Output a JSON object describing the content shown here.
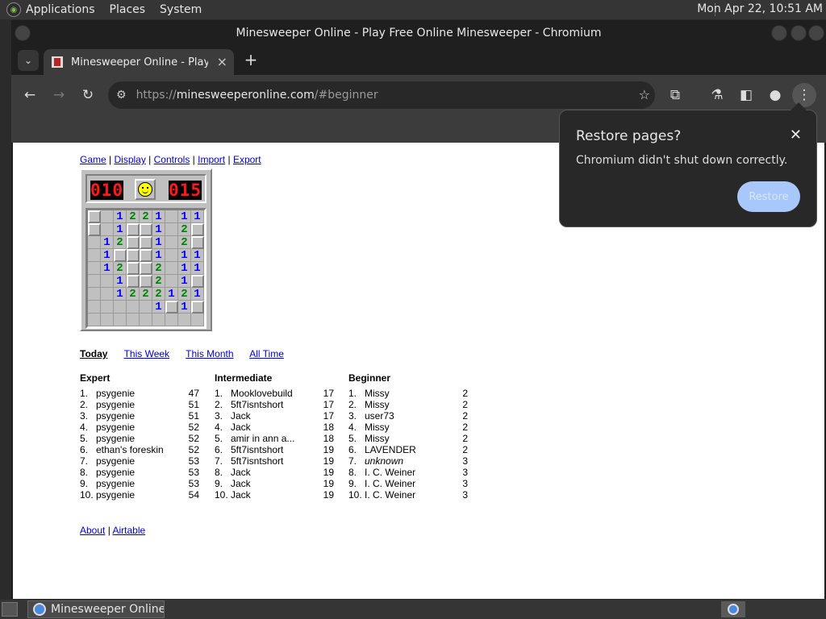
{
  "top_panel": {
    "menus": [
      "Applications",
      "Places",
      "System"
    ],
    "clock": "Mon Apr 22, 10:51 AM"
  },
  "window": {
    "title": "Minesweeper Online - Play Free Online Minesweeper - Chromium"
  },
  "tabs": {
    "active_title": "Minesweeper Online - Play Free Online Minesweeper",
    "new_tab_symbol": "+"
  },
  "omnibox": {
    "scheme": "https://",
    "host": "minesweeperonline.com",
    "path": "/#beginner"
  },
  "page": {
    "nav": [
      "Game",
      "Display",
      "Controls",
      "Import",
      "Export"
    ],
    "mine_counter": "010",
    "timer": "015",
    "board": [
      [
        "c",
        "o",
        "1",
        "2",
        "2",
        "1",
        "o",
        "1",
        "1"
      ],
      [
        "c",
        "o",
        "1",
        "c",
        "c",
        "1",
        "o",
        "2",
        "c"
      ],
      [
        "o",
        "1",
        "2",
        "c",
        "c",
        "1",
        "o",
        "2",
        "c"
      ],
      [
        "o",
        "1",
        "c",
        "c",
        "c",
        "1",
        "o",
        "1",
        "1"
      ],
      [
        "o",
        "1",
        "2",
        "c",
        "c",
        "2",
        "o",
        "1",
        "1"
      ],
      [
        "o",
        "o",
        "1",
        "c",
        "c",
        "2",
        "o",
        "1",
        "c"
      ],
      [
        "o",
        "o",
        "1",
        "2",
        "2",
        "2",
        "1",
        "2",
        "1"
      ],
      [
        "o",
        "o",
        "o",
        "o",
        "o",
        "1",
        "c",
        "1",
        "c"
      ],
      [
        "o",
        "o",
        "o",
        "o",
        "o",
        "o",
        "o",
        "o",
        "o"
      ]
    ],
    "periods": [
      "Today",
      "This Week",
      "This Month",
      "All Time"
    ],
    "active_period": "Today",
    "leaderboards": [
      {
        "heading": "Expert",
        "rows": [
          {
            "rank": "1.",
            "name": "psygenie",
            "time": "47"
          },
          {
            "rank": "2.",
            "name": "psygenie",
            "time": "51"
          },
          {
            "rank": "3.",
            "name": "psygenie",
            "time": "51"
          },
          {
            "rank": "4.",
            "name": "psygenie",
            "time": "52"
          },
          {
            "rank": "5.",
            "name": "psygenie",
            "time": "52"
          },
          {
            "rank": "6.",
            "name": "ethan's foreskin",
            "time": "52"
          },
          {
            "rank": "7.",
            "name": "psygenie",
            "time": "53"
          },
          {
            "rank": "8.",
            "name": "psygenie",
            "time": "53"
          },
          {
            "rank": "9.",
            "name": "psygenie",
            "time": "53"
          },
          {
            "rank": "10.",
            "name": "psygenie",
            "time": "54"
          }
        ]
      },
      {
        "heading": "Intermediate",
        "rows": [
          {
            "rank": "1.",
            "name": "Mooklovebuild",
            "time": "17"
          },
          {
            "rank": "2.",
            "name": "5ft7isntshort",
            "time": "17"
          },
          {
            "rank": "3.",
            "name": "Jack",
            "time": "17"
          },
          {
            "rank": "4.",
            "name": "Jack",
            "time": "18"
          },
          {
            "rank": "5.",
            "name": "amir in ann a...",
            "time": "18"
          },
          {
            "rank": "6.",
            "name": "5ft7isntshort",
            "time": "19"
          },
          {
            "rank": "7.",
            "name": "5ft7isntshort",
            "time": "19"
          },
          {
            "rank": "8.",
            "name": "Jack",
            "time": "19"
          },
          {
            "rank": "9.",
            "name": "Jack",
            "time": "19"
          },
          {
            "rank": "10.",
            "name": "Jack",
            "time": "19"
          }
        ]
      },
      {
        "heading": "Beginner",
        "rows": [
          {
            "rank": "1.",
            "name": "Missy",
            "time": "2"
          },
          {
            "rank": "2.",
            "name": "Missy",
            "time": "2"
          },
          {
            "rank": "3.",
            "name": "user73",
            "time": "2"
          },
          {
            "rank": "4.",
            "name": "Missy",
            "time": "2"
          },
          {
            "rank": "5.",
            "name": "Missy",
            "time": "2"
          },
          {
            "rank": "6.",
            "name": "LAVENDER",
            "time": "2"
          },
          {
            "rank": "7.",
            "name": "unknown",
            "time": "3",
            "italic": true
          },
          {
            "rank": "8.",
            "name": "I. C. Weiner",
            "time": "3"
          },
          {
            "rank": "9.",
            "name": "I. C. Weiner",
            "time": "3"
          },
          {
            "rank": "10.",
            "name": "I. C. Weiner",
            "time": "3"
          }
        ]
      }
    ],
    "footer": [
      "About",
      "Airtable"
    ]
  },
  "restore_popup": {
    "title": "Restore pages?",
    "message": "Chromium didn't shut down correctly.",
    "button": "Restore"
  },
  "taskbar": {
    "task_label": "Minesweeper Online..."
  }
}
